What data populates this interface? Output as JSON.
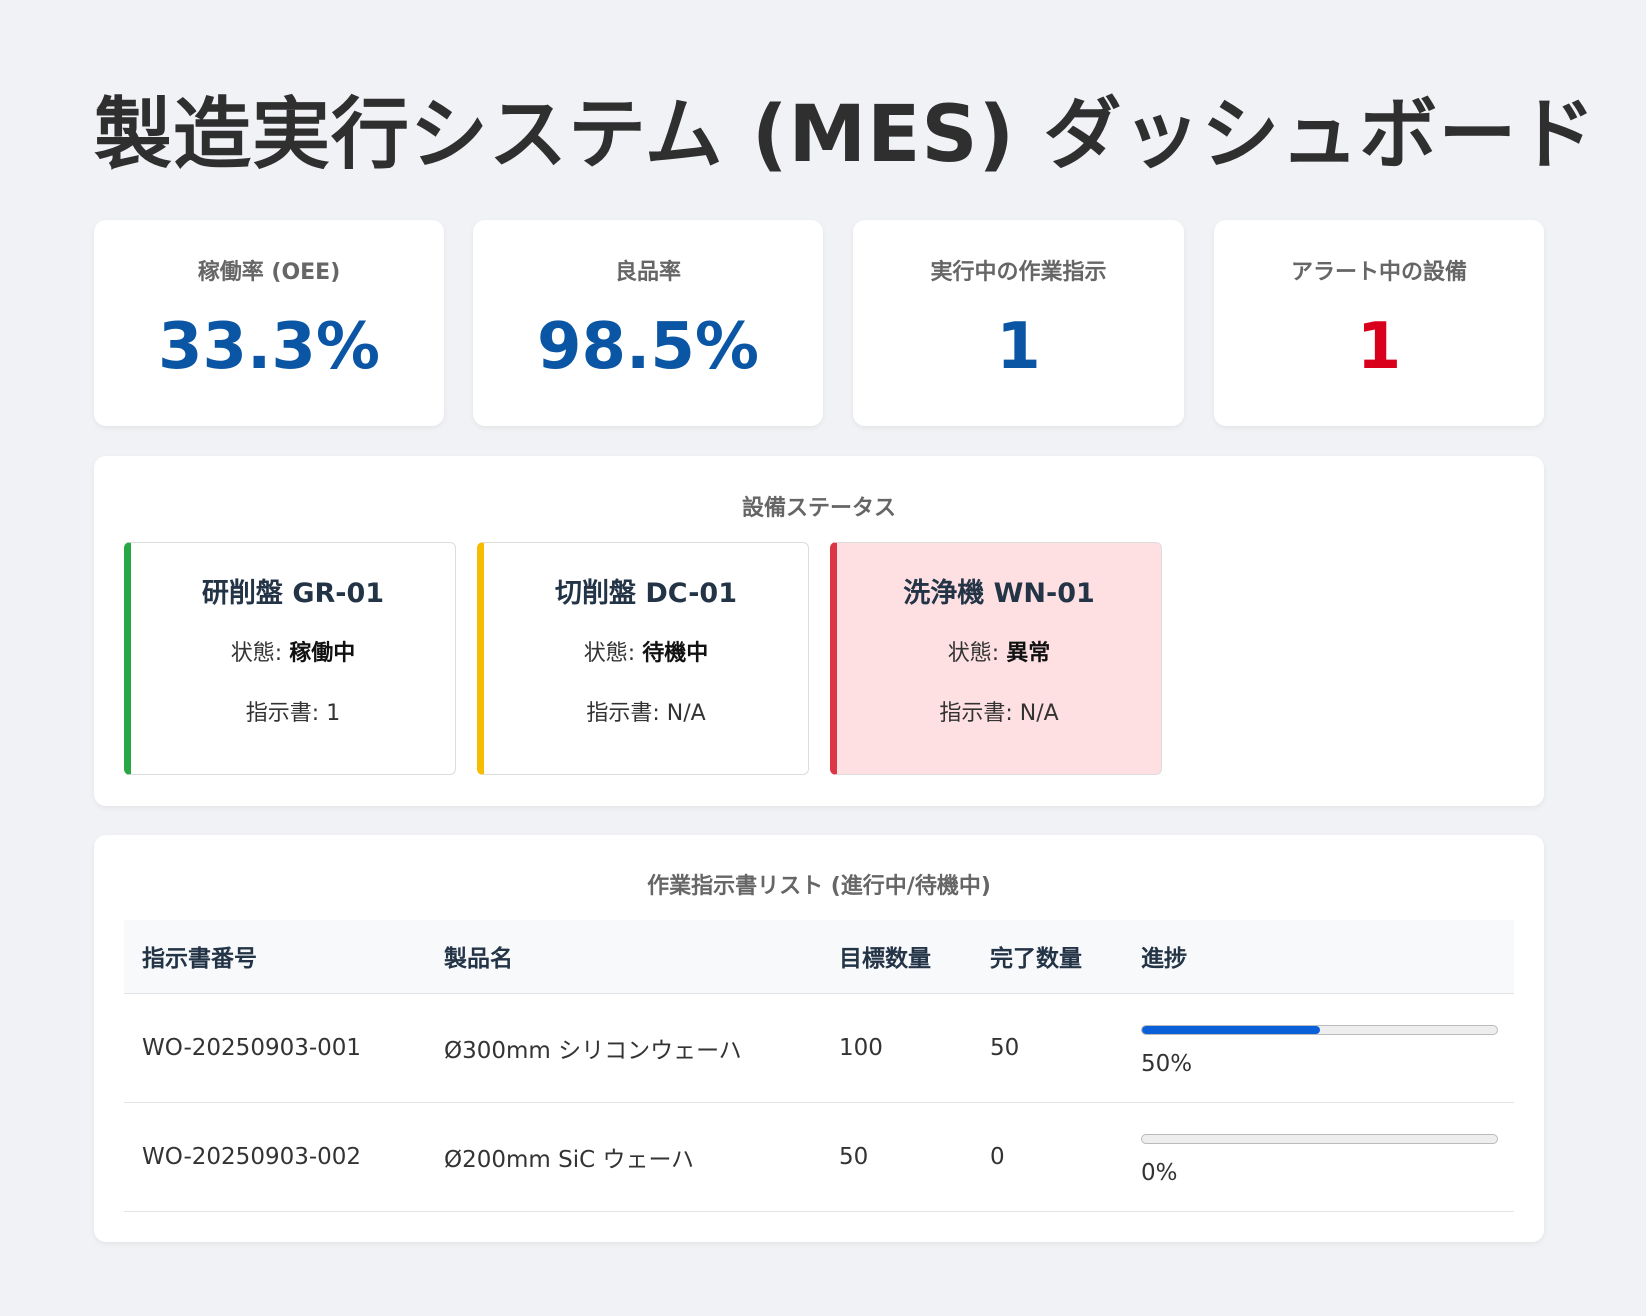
{
  "header": {
    "title": "製造実行システム (MES) ダッシュボード"
  },
  "kpis": [
    {
      "label": "稼働率 (OEE)",
      "value": "33.3%",
      "color": "#0a56a5"
    },
    {
      "label": "良品率",
      "value": "98.5%",
      "color": "#0a56a5"
    },
    {
      "label": "実行中の作業指示",
      "value": "1",
      "color": "#0a56a5"
    },
    {
      "label": "アラート中の設備",
      "value": "1",
      "color": "#d9001b"
    }
  ],
  "equipment": {
    "title": "設備ステータス",
    "status_prefix": "状態:",
    "order_prefix": "指示書:",
    "machines": [
      {
        "name": "研削盤 GR-01",
        "status": "稼働中",
        "order": "1",
        "status_color": "#28a745"
      },
      {
        "name": "切削盤 DC-01",
        "status": "待機中",
        "order": "N/A",
        "status_color": "#f5bc00"
      },
      {
        "name": "洗浄機 WN-01",
        "status": "異常",
        "order": "N/A",
        "status_color": "#dc3545"
      }
    ]
  },
  "work_orders": {
    "title": "作業指示書リスト (進行中/待機中)",
    "columns": [
      "指示書番号",
      "製品名",
      "目標数量",
      "完了数量",
      "進捗"
    ],
    "rows": [
      {
        "id": "WO-20250903-001",
        "product": "Ø300mm シリコンウェーハ",
        "target": "100",
        "done": "50",
        "progress": 0.5,
        "progress_label": "50%"
      },
      {
        "id": "WO-20250903-002",
        "product": "Ø200mm SiC ウェーハ",
        "target": "50",
        "done": "0",
        "progress": 0,
        "progress_label": "0%"
      }
    ]
  },
  "colors": {
    "progress_fill": "#0a60d8",
    "background": "#f0f2f5"
  }
}
